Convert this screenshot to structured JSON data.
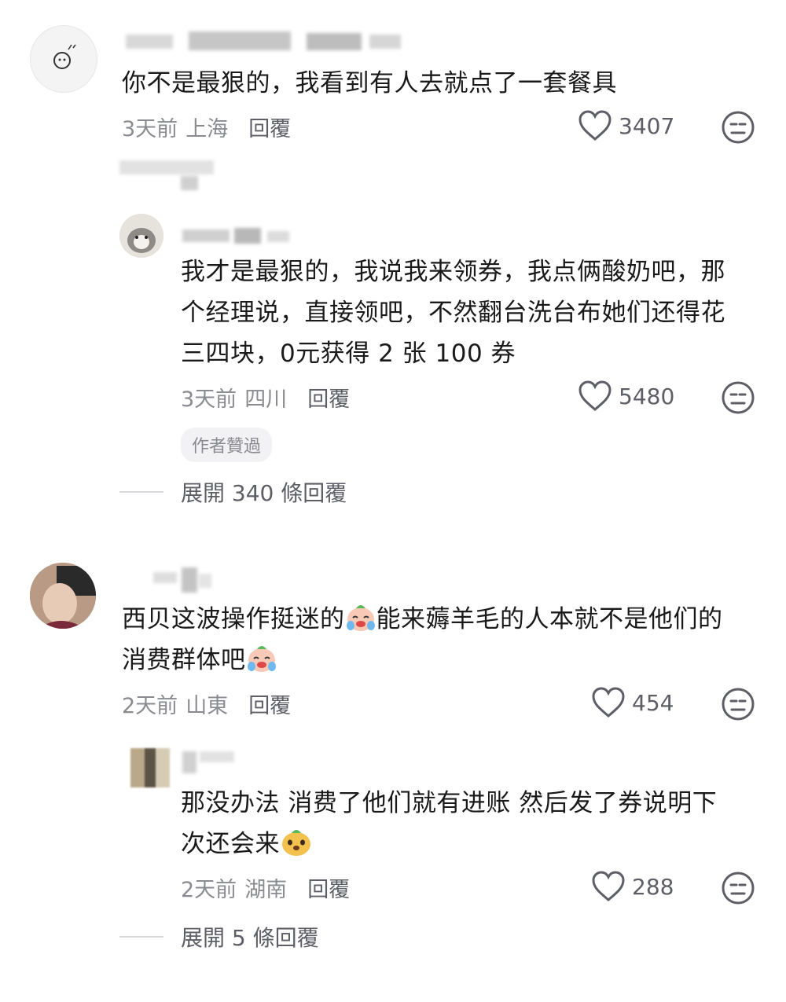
{
  "comments": [
    {
      "text": "你不是最狠的，我看到有人去就点了一套餐具",
      "time": "3天前",
      "location": "上海",
      "reply": "回覆",
      "likes": "3407",
      "reply_comment": {
        "text_lines": [
          "我才是最狠的，我说我来领券，我点俩酸奶吧，那",
          "个经理说，直接领吧，不然翻台洗台布她们还得花",
          "三四块，0元获得 2 张 100 券"
        ],
        "time": "3天前",
        "location": "四川",
        "reply": "回覆",
        "likes": "5480",
        "badge": "作者贊過"
      },
      "expand": "展開 340 條回覆"
    },
    {
      "text_line1_a": "西贝这波操作挺迷的",
      "text_line1_b": "能来薅羊毛的人本就不是他们的",
      "text_line2": "消费群体吧",
      "time": "2天前",
      "location": "山東",
      "reply": "回覆",
      "likes": "454",
      "reply_comment": {
        "text_line1": "那没办法 消费了他们就有进账 然后发了券说明下",
        "text_line2": "次还会来",
        "time": "2天前",
        "location": "湖南",
        "reply": "回覆",
        "likes": "288"
      },
      "expand": "展開 5 條回覆"
    }
  ],
  "icons": {
    "like": "heart-outline-icon",
    "dislike": "meh-face-icon",
    "emoji_cry": "crying-laughing-emoji",
    "emoji_smug": "smug-dog-emoji"
  },
  "colors": {
    "text": "#1a1a1a",
    "meta": "#8a8b91",
    "icon": "#5d5e66"
  }
}
